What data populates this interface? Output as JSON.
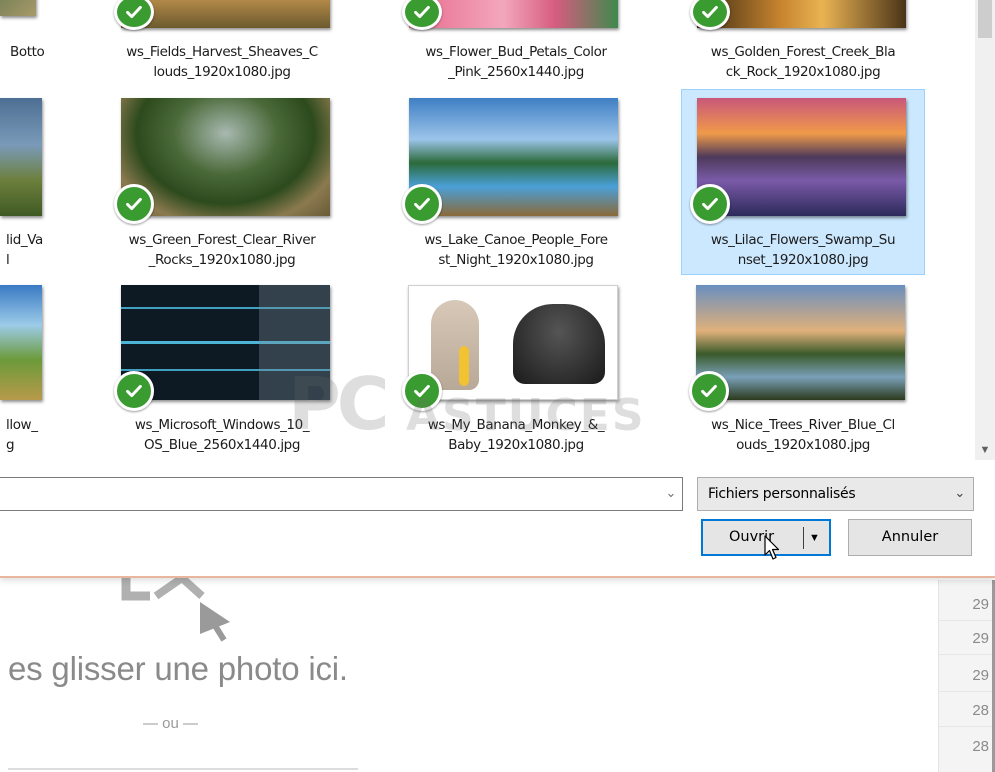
{
  "files": [
    {
      "name_lines": [
        "Botto",
        ""
      ],
      "partial": true
    },
    {
      "name_lines": [
        "ws_Fields_Harvest_Sheaves_C",
        "louds_1920x1080.jpg"
      ],
      "checked": true
    },
    {
      "name_lines": [
        "ws_Flower_Bud_Petals_Color",
        "_Pink_2560x1440.jpg"
      ],
      "checked": true
    },
    {
      "name_lines": [
        "ws_Golden_Forest_Creek_Bla",
        "ck_Rock_1920x1080.jpg"
      ],
      "checked": true
    },
    {
      "name_lines": [
        "lid_Va",
        "l"
      ],
      "partial": true
    },
    {
      "name_lines": [
        "ws_Green_Forest_Clear_River",
        "_Rocks_1920x1080.jpg"
      ],
      "checked": true
    },
    {
      "name_lines": [
        "ws_Lake_Canoe_People_Fore",
        "st_Night_1920x1080.jpg"
      ],
      "checked": true
    },
    {
      "name_lines": [
        "ws_Lilac_Flowers_Swamp_Su",
        "nset_1920x1080.jpg"
      ],
      "checked": true,
      "selected": true
    },
    {
      "name_lines": [
        "llow_",
        "g"
      ],
      "partial": true
    },
    {
      "name_lines": [
        "ws_Microsoft_Windows_10_",
        "OS_Blue_2560x1440.jpg"
      ],
      "checked": true
    },
    {
      "name_lines": [
        "ws_My_Banana_Monkey_&_",
        "Baby_1920x1080.jpg"
      ],
      "checked": true
    },
    {
      "name_lines": [
        "ws_Nice_Trees_River_Blue_Cl",
        "ouds_1920x1080.jpg"
      ],
      "checked": true
    }
  ],
  "dialog": {
    "filename_value": "",
    "filetype": "Fichiers personnalisés",
    "open_label": "Ouvrir",
    "cancel_label": "Annuler"
  },
  "watermark": {
    "pc": "PC",
    "astuces": "ASTUCES"
  },
  "page": {
    "drop_text": "es glisser une photo ici.",
    "or_text": "— ou —",
    "row_numbers": [
      "29",
      "29",
      "29",
      "28",
      "28"
    ]
  },
  "colors": {
    "check_green": "#3a9b31",
    "selection_bg": "#cce8ff",
    "accent_blue": "#0078d7",
    "dialog_border": "#e8b79b"
  }
}
